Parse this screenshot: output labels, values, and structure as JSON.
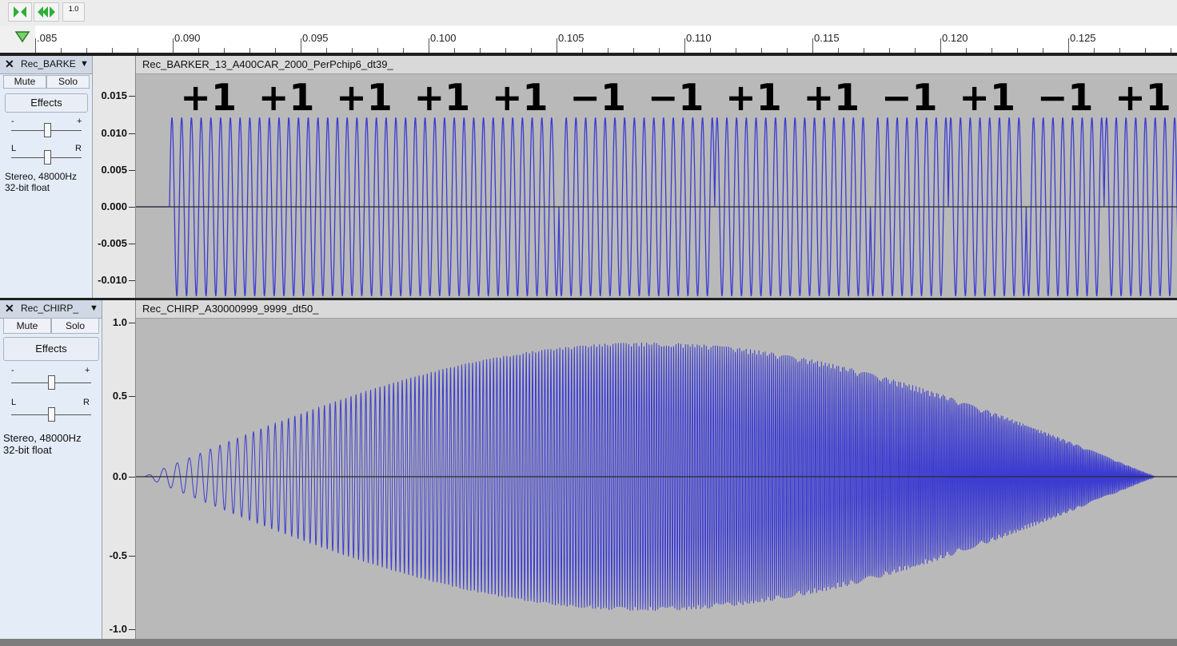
{
  "toolbar": {
    "play_button": "play-icon",
    "skip_button": "skip-end-icon",
    "speed_badge": "1.0"
  },
  "ruler": {
    "labels": [
      ".085",
      "0.090",
      "0.095",
      "0.100",
      "0.105",
      "0.110",
      "0.115",
      "0.120",
      "0.125"
    ]
  },
  "tracks": [
    {
      "name": "Rec_BARKE",
      "clip_title": "Rec_BARKER_13_A400CAR_2000_PerPchip6_dt39_",
      "mute": "Mute",
      "solo": "Solo",
      "effects": "Effects",
      "gain_minus": "-",
      "gain_plus": "+",
      "pan_left": "L",
      "pan_right": "R",
      "rate": "Stereo, 48000Hz",
      "format": "32-bit float",
      "vruler_labels": [
        "0.015",
        "0.010",
        "0.005",
        "0.000",
        "-0.005",
        "-0.010"
      ],
      "chips": [
        "+1",
        "+1",
        "+1",
        "+1",
        "+1",
        "−1",
        "−1",
        "+1",
        "+1",
        "−1",
        "+1",
        "−1",
        "+1"
      ]
    },
    {
      "name": "Rec_CHIRP_",
      "clip_title": "Rec_CHIRP_A30000999_9999_dt50_",
      "mute": "Mute",
      "solo": "Solo",
      "effects": "Effects",
      "gain_minus": "-",
      "gain_plus": "+",
      "pan_left": "L",
      "pan_right": "R",
      "rate": "Stereo, 48000Hz",
      "format": "32-bit float",
      "vruler_labels": [
        "1.0",
        "0.5",
        "0.0",
        "-0.5",
        "-1.0"
      ]
    }
  ],
  "colors": {
    "waveform": "#3b3bd1",
    "baseline": "#2a2a2a",
    "track_bg": "#b9b9b9"
  }
}
